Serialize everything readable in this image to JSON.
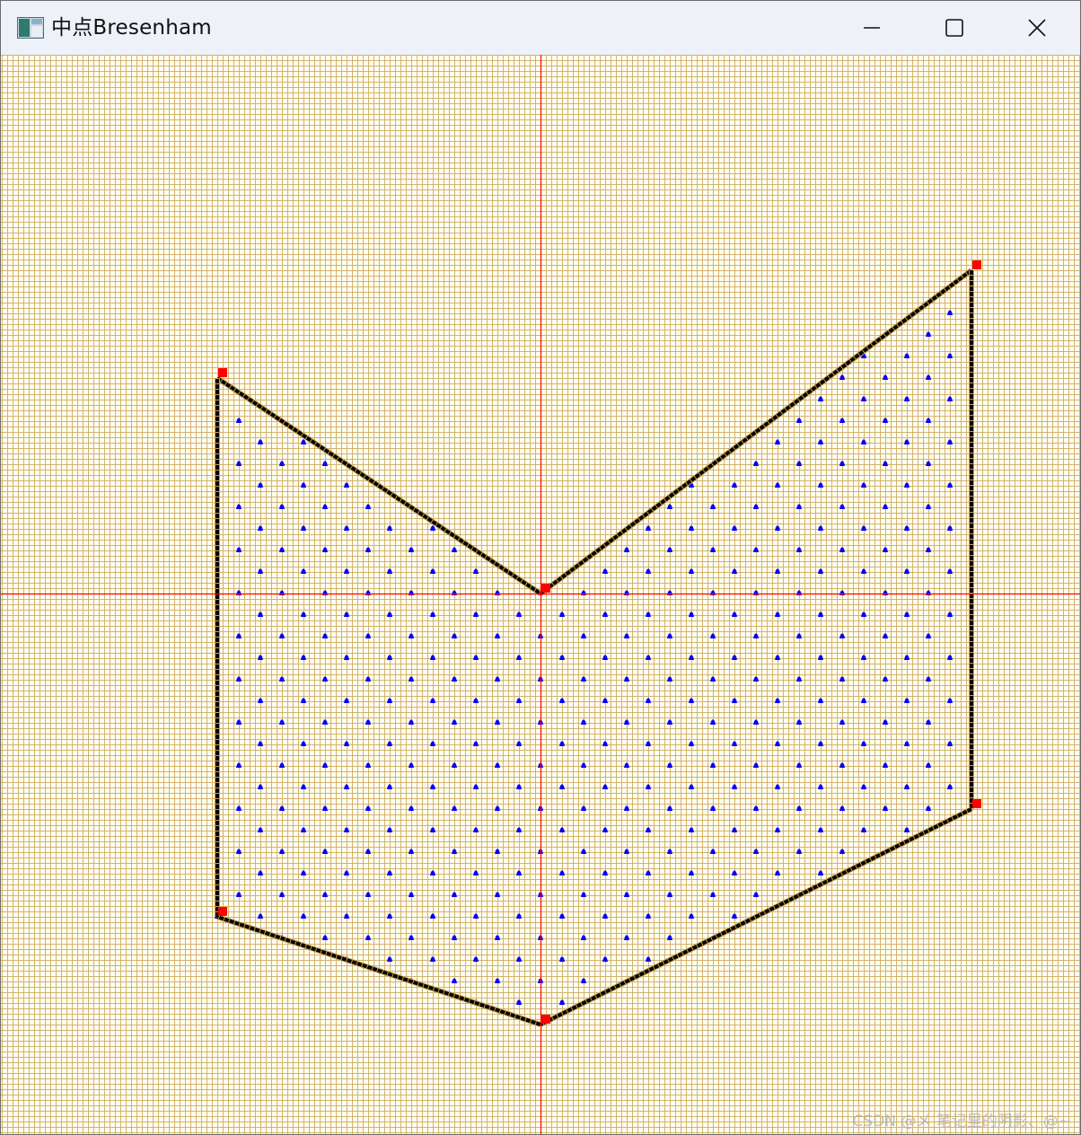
{
  "window": {
    "title": "中点Bresenham",
    "icon": "app-window-icon",
    "controls": {
      "minimize": "minimize-icon",
      "maximize": "maximize-icon",
      "close": "close-icon"
    }
  },
  "canvas": {
    "grid_color": "#d4b26a",
    "axis_color": "#ff0000",
    "edge_color": "#000000",
    "vertex_color": "#ff0000",
    "fill_color": "#0000ff",
    "background": "#fffef2",
    "polygon_vertices": [
      {
        "x": -15,
        "y": 10
      },
      {
        "x": 0,
        "y": 0
      },
      {
        "x": 20,
        "y": 15
      },
      {
        "x": 20,
        "y": -10
      },
      {
        "x": 0,
        "y": -20
      },
      {
        "x": -15,
        "y": -15
      }
    ]
  },
  "watermark": "CSDN @メ 笔记里的阴影、@~"
}
